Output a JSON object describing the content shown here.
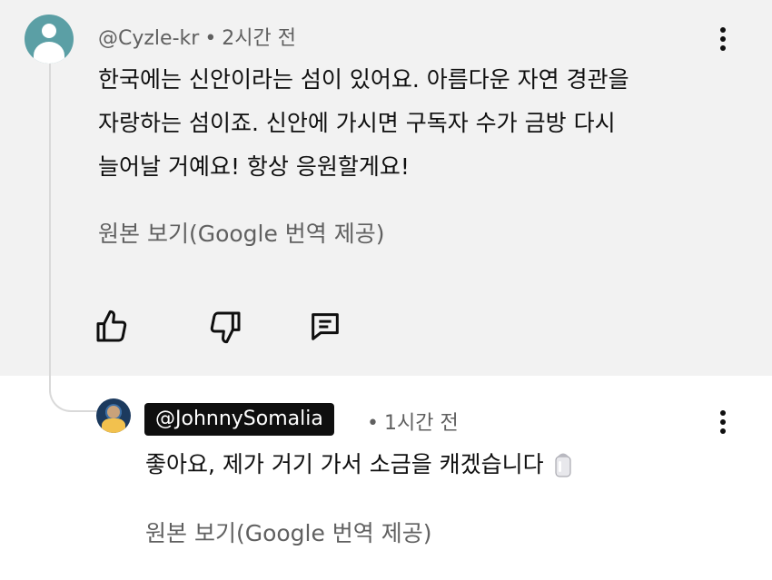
{
  "comment": {
    "author": "@Cyzle-kr",
    "time": "2시간 전",
    "text_lines": [
      "한국에는 신안이라는 섬이 있어요. 아름다운 자연 경관을",
      "자랑하는 섬이죠. 신안에 가시면 구독자 수가 금방 다시",
      "늘어날 거예요! 항상 응원할게요!"
    ],
    "translate_label": "원본 보기(Google 번역 제공)",
    "actions": [
      "thumbs-up-icon",
      "thumbs-down-icon",
      "reply-icon"
    ]
  },
  "reply": {
    "author": "@JohnnySomalia",
    "time": "1시간 전",
    "text": "좋아요, 제가 거기 가서 소금을 캐겠습니다",
    "emoji": "salt-shaker-icon",
    "translate_label": "원본 보기(Google 번역 제공)"
  },
  "separator": "•",
  "colors": {
    "background_top": "#f2f2f2",
    "text": "#0f0f0f",
    "secondary": "#606060",
    "mention_bg": "#0f0f0f"
  }
}
